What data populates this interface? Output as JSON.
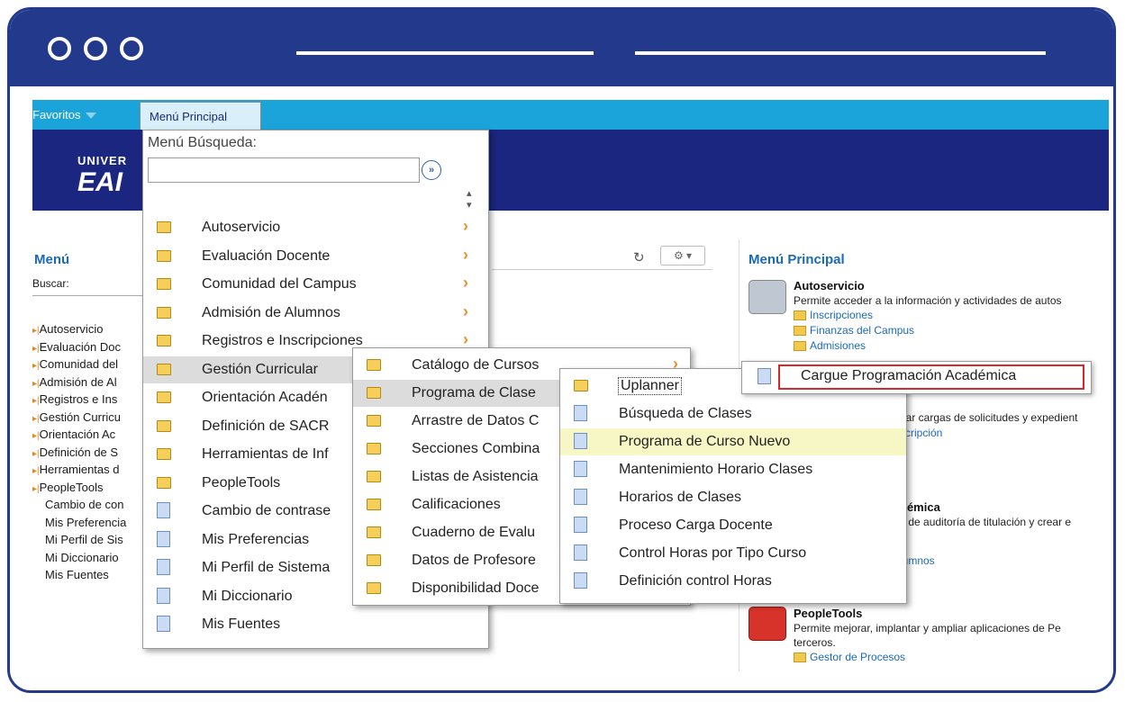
{
  "top_nav": {
    "favoritos_label": "Favoritos",
    "menu_principal_label": "Menú Principal"
  },
  "banner": {
    "logo_top": "UNIVER",
    "logo_big": "EAI"
  },
  "left_menu": {
    "title": "Menú",
    "buscar_label": "Buscar:",
    "folder_items": [
      "Autoservicio",
      "Evaluación Doc",
      "Comunidad del",
      "Admisión de Al",
      "Registros e Ins",
      "Gestión Curricu",
      "Orientación Ac",
      "Definición de S",
      "Herramientas d",
      "PeopleTools"
    ],
    "plain_items": [
      "Cambio de con",
      "Mis Preferencia",
      "Mi Perfil de Sis",
      "Mi Diccionario",
      "Mis Fuentes"
    ]
  },
  "dropdown1": {
    "search_label": "Menú Búsqueda:",
    "search_value": "",
    "go_icon": "double-chevron-right-icon",
    "items": [
      {
        "label": "Autoservicio",
        "type": "folder",
        "chevron": true
      },
      {
        "label": "Evaluación Docente",
        "type": "folder",
        "chevron": true
      },
      {
        "label": "Comunidad del Campus",
        "type": "folder",
        "chevron": true
      },
      {
        "label": "Admisión de Alumnos",
        "type": "folder",
        "chevron": true
      },
      {
        "label": "Registros e Inscripciones",
        "type": "folder",
        "chevron": true
      },
      {
        "label": "Gestión Curricular",
        "type": "folder",
        "chevron": false
      },
      {
        "label": "Orientación Acadén",
        "type": "folder",
        "chevron": false
      },
      {
        "label": "Definición de SACR",
        "type": "folder",
        "chevron": false
      },
      {
        "label": "Herramientas de Inf",
        "type": "folder",
        "chevron": false
      },
      {
        "label": "PeopleTools",
        "type": "folder",
        "chevron": false
      },
      {
        "label": "Cambio de contrase",
        "type": "doc",
        "chevron": false
      },
      {
        "label": "Mis Preferencias",
        "type": "doc",
        "chevron": false
      },
      {
        "label": "Mi Perfil de Sistema",
        "type": "doc",
        "chevron": false
      },
      {
        "label": "Mi Diccionario",
        "type": "doc",
        "chevron": false
      },
      {
        "label": "Mis Fuentes",
        "type": "doc",
        "chevron": false
      }
    ]
  },
  "dropdown2": {
    "items": [
      {
        "label": "Catálogo de Cursos",
        "chevron": true
      },
      {
        "label": "Programa de Clase",
        "chevron": false
      },
      {
        "label": "Arrastre de Datos C",
        "chevron": false
      },
      {
        "label": "Secciones Combina",
        "chevron": false
      },
      {
        "label": "Listas de Asistencia",
        "chevron": false
      },
      {
        "label": "Calificaciones",
        "chevron": false
      },
      {
        "label": "Cuaderno de Evalu",
        "chevron": false
      },
      {
        "label": "Datos de Profesore",
        "chevron": false
      },
      {
        "label": "Disponibilidad Doce",
        "chevron": false
      }
    ]
  },
  "dropdown3": {
    "items": [
      {
        "label": "Uplanner",
        "type": "folder"
      },
      {
        "label": "Búsqueda de Clases",
        "type": "doc"
      },
      {
        "label": "Programa de Curso Nuevo",
        "type": "doc"
      },
      {
        "label": "Mantenimiento Horario Clases",
        "type": "doc"
      },
      {
        "label": "Horarios de Clases",
        "type": "doc"
      },
      {
        "label": "Proceso Carga Docente",
        "type": "doc"
      },
      {
        "label": "Control Horas por Tipo Curso",
        "type": "doc"
      },
      {
        "label": "Definición control Horas",
        "type": "doc"
      }
    ]
  },
  "flyout": {
    "label": "Cargue Programación Académica",
    "highlight_color": "#d9262b"
  },
  "right_panel": {
    "title": "Menú Principal",
    "autoservicio_title": "Autoservicio",
    "autoservicio_text": "Permite acceder a la información y actividades de autos",
    "autoservicio_links": [
      "Inscripciones",
      "Finanzas del Campus",
      "Admisiones"
    ],
    "partial_text_1": "ear cargas de solicitudes y expedient",
    "partial_link_1": "scripción",
    "academica_title": "démica",
    "academica_text": "s de auditoría de titulación y crear e",
    "academica_link": "lumnos",
    "peopletools_title": "PeopleTools",
    "peopletools_text_1": "Permite mejorar, implantar y ampliar aplicaciones de Pe",
    "peopletools_text_2": "terceros.",
    "peopletools_link": "Gestor de Procesos"
  },
  "colors": {
    "frame": "#233a8c",
    "top_nav": "#1aa4da",
    "banner": "#1a2680",
    "accent_link": "#1b6ab7",
    "chevron": "#e8902a"
  }
}
